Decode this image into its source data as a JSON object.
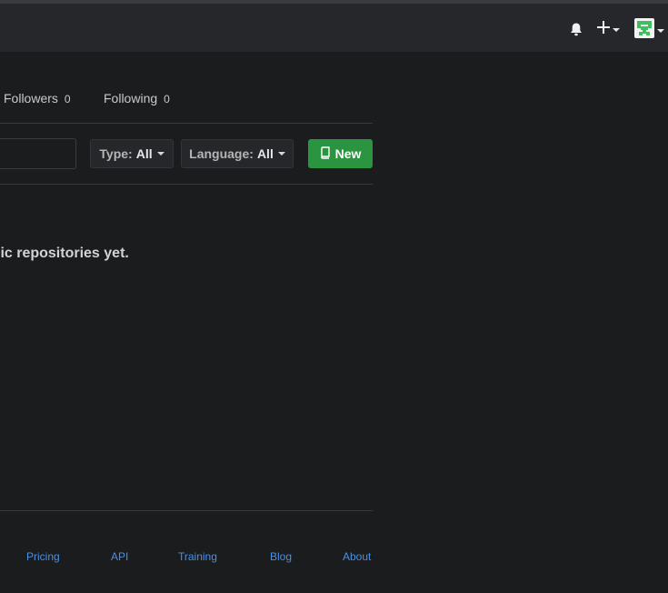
{
  "header": {
    "icons": {
      "notifications": "bell-icon",
      "create": "plus-icon",
      "user": "avatar-icon"
    }
  },
  "profile_nav": {
    "followers": {
      "label": "Followers",
      "count": "0"
    },
    "following": {
      "label": "Following",
      "count": "0"
    }
  },
  "filters": {
    "search_value": "",
    "type": {
      "label": "Type:",
      "value": "All"
    },
    "language": {
      "label": "Language:",
      "value": "All"
    },
    "new_button": {
      "label": "New",
      "icon": "repo-book-icon"
    }
  },
  "empty_state": {
    "message": "lic repositories yet."
  },
  "footer": {
    "links": [
      "Pricing",
      "API",
      "Training",
      "Blog",
      "About"
    ]
  },
  "colors": {
    "background": "#1b1c1e",
    "header": "#25272a",
    "accent_green": "#2b9440",
    "link_blue": "#4a90e2"
  }
}
